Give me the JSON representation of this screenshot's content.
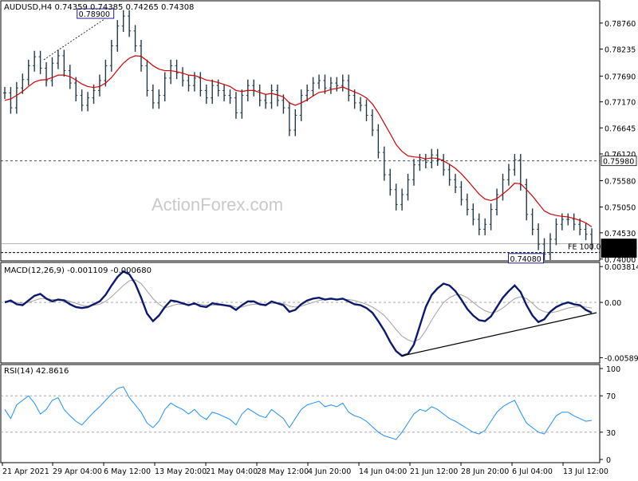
{
  "watermark": "ActionForex.com",
  "price_pane": {
    "header": "AUDUSD,H4  0.74359 0.74385 0.74265 0.74308",
    "y_min": 0.7398,
    "y_max": 0.7916,
    "tick_labels": [
      "0.78760",
      "0.78235",
      "0.77690",
      "0.77170",
      "0.76645",
      "0.76120",
      "0.75580",
      "0.75050",
      "0.74530",
      "0.74000"
    ],
    "tick_values": [
      0.7876,
      0.78235,
      0.7769,
      0.7717,
      0.76645,
      0.7612,
      0.7558,
      0.7505,
      0.7453,
      0.74
    ],
    "high_box": "0.78900",
    "low_box": "0.74080",
    "fe_label": "FE 100.0",
    "level_labels": [
      "0.75980",
      "0.74308",
      "0.74130"
    ],
    "level_values": [
      0.7598,
      0.74308,
      0.7413
    ],
    "colors": {
      "candle": "#1f3a4a",
      "ma": "#d40000",
      "level_box": "#1c1c8c",
      "last_box": "#000000"
    }
  },
  "macd_pane": {
    "header": "MACD(12,26,9) -0.001109 -0.000680",
    "top_label": "0.003814",
    "zero_label": "0.00",
    "bottom_label": "-0.005895",
    "y_min": -0.0062,
    "y_max": 0.004,
    "colors": {
      "macd": "#0b1a6e",
      "signal": "#a0a0a0",
      "trend": "#000000"
    }
  },
  "rsi_pane": {
    "header": "RSI(14) 42.8616",
    "tick_labels": [
      "100",
      "70",
      "30",
      "0"
    ],
    "tick_values": [
      100,
      70,
      30,
      0
    ],
    "color": "#1e90ff"
  },
  "x_axis": {
    "labels": [
      "21 Apr 2021",
      "29 Apr 04:00",
      "6 May 12:00",
      "13 May 20:00",
      "21 May 04:00",
      "28 May 12:00",
      "4 Jun 20:00",
      "14 Jun 04:00",
      "21 Jun 12:00",
      "28 Jun 20:00",
      "6 Jul 04:00",
      "13 Jul 12:00"
    ]
  },
  "chart_data": [
    {
      "type": "line",
      "title": "AUDUSD,H4",
      "xlabel": "",
      "ylabel": "",
      "ylim": [
        0.7398,
        0.7916
      ],
      "grid": false,
      "series": [
        {
          "values": [
            0.7735,
            0.7705,
            0.7745,
            0.7762,
            0.779,
            0.7808,
            0.7785,
            0.776,
            0.7795,
            0.781,
            0.778,
            0.7755,
            0.773,
            0.771,
            0.7725,
            0.774,
            0.776,
            0.779,
            0.783,
            0.787,
            0.789,
            0.786,
            0.783,
            0.779,
            0.774,
            0.7715,
            0.773,
            0.7765,
            0.779,
            0.7775,
            0.776,
            0.775,
            0.7765,
            0.774,
            0.7725,
            0.775,
            0.774,
            0.773,
            0.7725,
            0.7695,
            0.773,
            0.775,
            0.774,
            0.772,
            0.7715,
            0.774,
            0.772,
            0.7705,
            0.766,
            0.769,
            0.773,
            0.774,
            0.7755,
            0.776,
            0.7745,
            0.7755,
            0.775,
            0.776,
            0.773,
            0.7715,
            0.771,
            0.769,
            0.766,
            0.7615,
            0.757,
            0.754,
            0.751,
            0.753,
            0.756,
            0.759,
            0.76,
            0.7595,
            0.761,
            0.76,
            0.758,
            0.756,
            0.7545,
            0.752,
            0.75,
            0.748,
            0.746,
            0.747,
            0.75,
            0.753,
            0.756,
            0.758,
            0.76,
            0.755,
            0.749,
            0.746,
            0.743,
            0.741,
            0.744,
            0.747,
            0.748,
            0.748,
            0.747,
            0.746,
            0.745,
            0.743
          ]
        },
        {
          "name": "MA",
          "values": [
            0.772,
            0.7723,
            0.773,
            0.7738,
            0.7748,
            0.7757,
            0.7761,
            0.7762,
            0.7766,
            0.7771,
            0.7771,
            0.7768,
            0.7761,
            0.7753,
            0.7748,
            0.7746,
            0.7748,
            0.7755,
            0.7766,
            0.7781,
            0.7795,
            0.7805,
            0.781,
            0.7809,
            0.78,
            0.779,
            0.7783,
            0.778,
            0.778,
            0.7778,
            0.7775,
            0.7771,
            0.777,
            0.7766,
            0.7761,
            0.7759,
            0.7756,
            0.7752,
            0.7748,
            0.774,
            0.7738,
            0.774,
            0.774,
            0.7736,
            0.7732,
            0.7734,
            0.7731,
            0.7727,
            0.7715,
            0.771,
            0.7715,
            0.7721,
            0.7729,
            0.7736,
            0.7738,
            0.7742,
            0.7744,
            0.7747,
            0.7742,
            0.7737,
            0.7732,
            0.7725,
            0.7713,
            0.7695,
            0.7674,
            0.7653,
            0.7631,
            0.7617,
            0.7608,
            0.7606,
            0.7605,
            0.7602,
            0.7604,
            0.7603,
            0.7598,
            0.7591,
            0.7583,
            0.7572,
            0.7559,
            0.7545,
            0.7531,
            0.7521,
            0.7518,
            0.7522,
            0.7531,
            0.7541,
            0.7553,
            0.7552,
            0.754,
            0.7527,
            0.7512,
            0.7497,
            0.7491,
            0.7488,
            0.7486,
            0.7485,
            0.7482,
            0.7478,
            0.7473,
            0.7465
          ]
        }
      ]
    },
    {
      "type": "line",
      "title": "MACD(12,26,9)",
      "xlabel": "",
      "ylabel": "",
      "ylim": [
        -0.0062,
        0.004
      ],
      "series": [
        {
          "values": [
            0.0,
            0.0002,
            -0.0002,
            -0.0003,
            0.0002,
            0.0007,
            0.0009,
            0.0004,
            0.0001,
            0.0003,
            0.0002,
            -0.0002,
            -0.0005,
            -0.0006,
            -0.0005,
            -0.0002,
            0.0001,
            0.0008,
            0.0018,
            0.0027,
            0.0033,
            0.003,
            0.002,
            0.0005,
            -0.0012,
            -0.002,
            -0.0014,
            -0.0005,
            0.0002,
            0.0001,
            -0.0001,
            -0.0003,
            -0.0001,
            -0.0004,
            -0.0005,
            -0.0001,
            -0.0002,
            -0.0003,
            -0.0004,
            -0.0008,
            -0.0003,
            0.0001,
            0.0001,
            -0.0002,
            -0.0003,
            0.0001,
            -0.0001,
            -0.0003,
            -0.001,
            -0.0008,
            -0.0002,
            0.0002,
            0.0004,
            0.0005,
            0.0003,
            0.0004,
            0.0003,
            0.0004,
            0.0001,
            -0.0002,
            -0.0003,
            -0.0006,
            -0.0011,
            -0.002,
            -0.003,
            -0.0042,
            -0.0052,
            -0.0057,
            -0.0055,
            -0.0045,
            -0.0025,
            -0.0005,
            0.0008,
            0.0015,
            0.002,
            0.0018,
            0.0012,
            0.0003,
            -0.0007,
            -0.0014,
            -0.0019,
            -0.002,
            -0.0015,
            -0.0005,
            0.0005,
            0.0012,
            0.0018,
            0.0011,
            -0.0003,
            -0.0014,
            -0.0021,
            -0.0018,
            -0.001,
            -0.0005,
            -0.0002,
            0.0,
            -0.0002,
            -0.0003,
            -0.0008,
            -0.0011
          ]
        },
        {
          "values": [
            0.0001,
            0.0001,
            0.0,
            -0.0001,
            0.0,
            0.0002,
            0.0004,
            0.0004,
            0.0003,
            0.0003,
            0.0003,
            0.0001,
            -0.0001,
            -0.0003,
            -0.0004,
            -0.0003,
            -0.0002,
            0.0001,
            0.0006,
            0.0012,
            0.0018,
            0.0023,
            0.0024,
            0.002,
            0.0012,
            0.0004,
            -0.0002,
            -0.0006,
            -0.0004,
            -0.0002,
            -0.0002,
            -0.0002,
            -0.0002,
            -0.0002,
            -0.0003,
            -0.0003,
            -0.0003,
            -0.0003,
            -0.0003,
            -0.0005,
            -0.0005,
            -0.0003,
            -0.0002,
            -0.0002,
            -0.0002,
            -0.0001,
            -0.0001,
            -0.0001,
            -0.0004,
            -0.0005,
            -0.0004,
            -0.0002,
            0.0,
            0.0002,
            0.0003,
            0.0003,
            0.0003,
            0.0003,
            0.0003,
            0.0002,
            0.0,
            -0.0002,
            -0.0005,
            -0.0009,
            -0.0014,
            -0.0021,
            -0.0029,
            -0.0036,
            -0.004,
            -0.0042,
            -0.0039,
            -0.003,
            -0.0019,
            -0.0009,
            0.0,
            0.0005,
            0.0008,
            0.0008,
            0.0005,
            0.0,
            -0.0005,
            -0.0009,
            -0.0011,
            -0.001,
            -0.0006,
            -0.0001,
            0.0004,
            0.0006,
            0.0004,
            -0.0001,
            -0.0007,
            -0.001,
            -0.0011,
            -0.001,
            -0.0008,
            -0.0006,
            -0.0005,
            -0.0004,
            -0.0005,
            -0.0006
          ]
        }
      ]
    },
    {
      "type": "line",
      "title": "RSI(14)",
      "xlabel": "",
      "ylabel": "",
      "ylim": [
        0,
        100
      ],
      "series": [
        {
          "values": [
            55,
            45,
            60,
            65,
            70,
            62,
            50,
            55,
            65,
            68,
            55,
            48,
            42,
            38,
            45,
            52,
            58,
            65,
            72,
            78,
            80,
            68,
            60,
            52,
            40,
            35,
            42,
            55,
            62,
            58,
            55,
            50,
            55,
            48,
            44,
            52,
            50,
            47,
            44,
            38,
            50,
            56,
            52,
            48,
            46,
            55,
            50,
            45,
            35,
            45,
            55,
            60,
            62,
            64,
            58,
            60,
            58,
            62,
            52,
            48,
            46,
            42,
            36,
            30,
            26,
            24,
            22,
            30,
            40,
            50,
            55,
            53,
            58,
            55,
            50,
            45,
            42,
            38,
            34,
            30,
            28,
            32,
            42,
            52,
            58,
            62,
            65,
            52,
            40,
            35,
            30,
            28,
            38,
            48,
            52,
            52,
            48,
            45,
            42,
            43
          ]
        }
      ]
    }
  ]
}
